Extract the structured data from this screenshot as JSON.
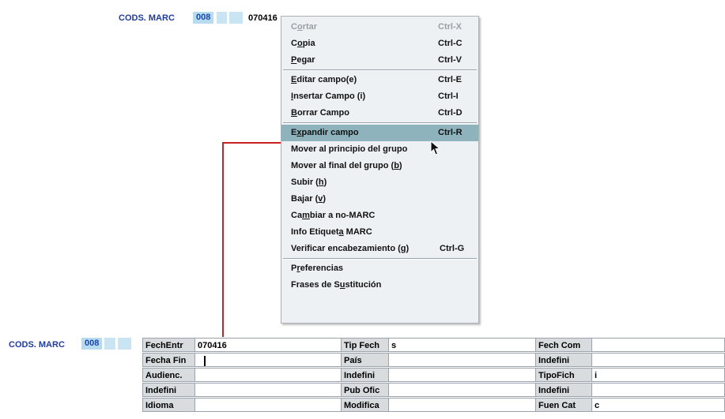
{
  "top_row": {
    "label": "CODS. MARC",
    "tag": "008",
    "value": "070416"
  },
  "context_menu": {
    "items": [
      {
        "label_parts": [
          "C",
          "o",
          "rtar"
        ],
        "underline": 1,
        "shortcut": "Ctrl-X",
        "disabled": true
      },
      {
        "label_parts": [
          "C",
          "o",
          "pia"
        ],
        "underline": 1,
        "shortcut": "Ctrl-C"
      },
      {
        "label_parts": [
          "",
          "P",
          "egar"
        ],
        "underline": 1,
        "shortcut": "Ctrl-V"
      },
      {
        "label_parts": [
          "",
          "E",
          "ditar campo(e)"
        ],
        "underline": 1,
        "shortcut": "Ctrl-E"
      },
      {
        "label_parts": [
          "",
          "I",
          "nsertar Campo (i)"
        ],
        "underline": 1,
        "shortcut": "Ctrl-I"
      },
      {
        "label_parts": [
          "",
          "B",
          "orrar Campo"
        ],
        "underline": 1,
        "shortcut": "Ctrl-D"
      },
      {
        "label_parts": [
          "E",
          "x",
          "pandir campo"
        ],
        "underline": 1,
        "shortcut": "Ctrl-R",
        "selected": true
      },
      {
        "label_parts": [
          "Mover al principio del grupo",
          "",
          ""
        ],
        "underline": 0,
        "shortcut": ""
      },
      {
        "label_parts": [
          "Mover al final del grupo (",
          "b",
          ")"
        ],
        "underline": 1,
        "shortcut": ""
      },
      {
        "label_parts": [
          "Subir (",
          "h",
          ")"
        ],
        "underline": 1,
        "shortcut": ""
      },
      {
        "label_parts": [
          "Bajar (",
          "v",
          ")"
        ],
        "underline": 1,
        "shortcut": ""
      },
      {
        "label_parts": [
          "Ca",
          "m",
          "biar a no-MARC"
        ],
        "underline": 1,
        "shortcut": ""
      },
      {
        "label_parts": [
          "Info Etiquet",
          "a",
          " MARC"
        ],
        "underline": 1,
        "shortcut": ""
      },
      {
        "label_parts": [
          "Verificar encabezamiento (",
          "g",
          ")"
        ],
        "underline": 1,
        "shortcut": "Ctrl-G"
      },
      {
        "label_parts": [
          "P",
          "r",
          "eferencias"
        ],
        "underline": 1,
        "shortcut": ""
      },
      {
        "label_parts": [
          "Frases de S",
          "u",
          "stitución"
        ],
        "underline": 1,
        "shortcut": ""
      }
    ]
  },
  "bottom_row": {
    "label": "CODS. MARC",
    "tag": "008"
  },
  "grid": {
    "rows": [
      [
        {
          "label": "FechEntr",
          "value": "070416"
        },
        {
          "label": "Tip Fech",
          "value": "s"
        },
        {
          "label": "Fech Com",
          "value": ""
        }
      ],
      [
        {
          "label": "Fecha Fin",
          "value": ""
        },
        {
          "label": "País",
          "value": ""
        },
        {
          "label": "Indefini",
          "value": ""
        }
      ],
      [
        {
          "label": "Audienc.",
          "value": ""
        },
        {
          "label": "Indefini",
          "value": ""
        },
        {
          "label": "TipoFich",
          "value": "i"
        }
      ],
      [
        {
          "label": "Indefini",
          "value": ""
        },
        {
          "label": "Pub Ofic",
          "value": ""
        },
        {
          "label": "Indefini",
          "value": ""
        }
      ],
      [
        {
          "label": "Idioma",
          "value": ""
        },
        {
          "label": "Modifica",
          "value": ""
        },
        {
          "label": "Fuen Cat",
          "value": "c"
        }
      ]
    ]
  },
  "colors": {
    "accent_label": "#1f3c9c",
    "tag_bg": "#b8dcef",
    "menu_selected": "#8eb3bd",
    "connector": "#cc1f1f"
  }
}
